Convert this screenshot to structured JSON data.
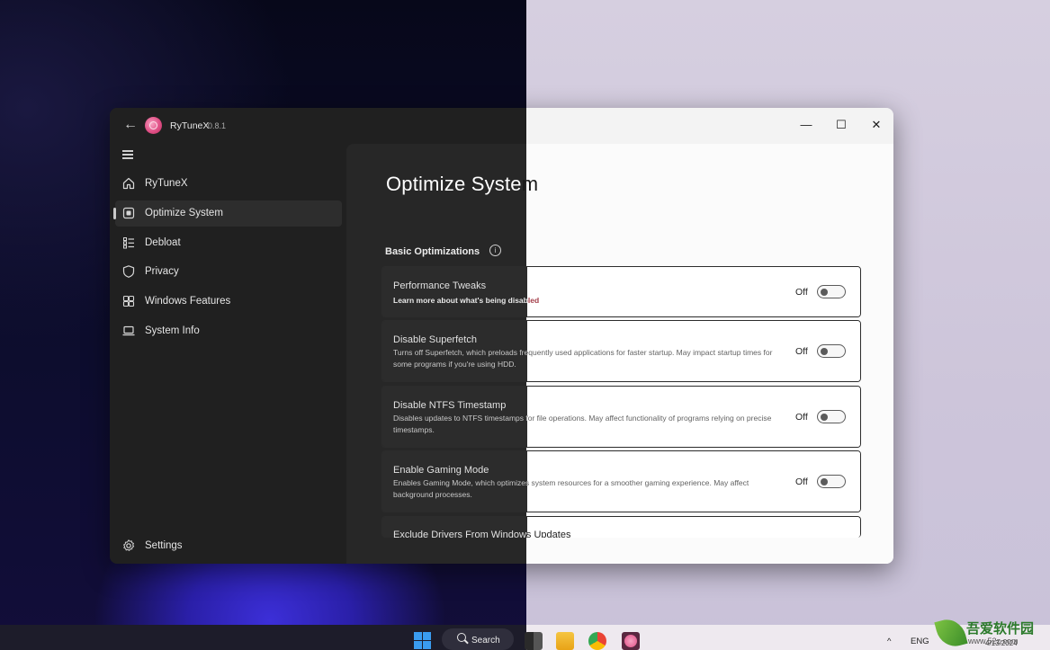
{
  "window": {
    "app_name": "RyTuneX",
    "version": "0.8.1",
    "back_glyph": "←",
    "minimize_glyph": "—",
    "maximize_glyph": "☐",
    "close_glyph": "✕"
  },
  "sidebar": {
    "items": [
      {
        "label": "RyTuneX",
        "icon": "home-icon",
        "active": false
      },
      {
        "label": "Optimize System",
        "icon": "optimize-icon",
        "active": true
      },
      {
        "label": "Debloat",
        "icon": "list-icon",
        "active": false
      },
      {
        "label": "Privacy",
        "icon": "shield-icon",
        "active": false
      },
      {
        "label": "Windows Features",
        "icon": "grid-icon",
        "active": false
      },
      {
        "label": "System Info",
        "icon": "laptop-icon",
        "active": false
      }
    ],
    "settings_label": "Settings"
  },
  "main": {
    "title_head": "Optimize Syste",
    "title_tail": "m",
    "section_title": "Basic Optimizations",
    "info_glyph": "i",
    "cards": [
      {
        "title": "Performance Tweaks",
        "link": "Learn more about what's being disabled",
        "state": "Off"
      },
      {
        "title": "Disable Superfetch",
        "desc": "Turns off Superfetch, which preloads frequently used applications for faster startup. May impact startup times for some programs if you're using HDD.",
        "state": "Off"
      },
      {
        "title": "Disable NTFS Timestamp",
        "desc": "Disables updates to NTFS timestamps for file operations. May affect functionality of programs relying on precise timestamps.",
        "state": "Off"
      },
      {
        "title": "Enable Gaming Mode",
        "desc": "Enables Gaming Mode, which optimizes system resources for a smoother gaming experience. May affect background processes.",
        "state": "Off"
      },
      {
        "title": "Exclude Drivers From Windows Updates"
      }
    ]
  },
  "taskbar": {
    "search_label": "Search",
    "language": "ENG",
    "clock_date": "4/13/2024"
  },
  "watermark": {
    "name": "吾爱软件园",
    "url": "www.52z.com"
  },
  "colors": {
    "accent": "#e04f86",
    "link_light": "#a23b46"
  }
}
